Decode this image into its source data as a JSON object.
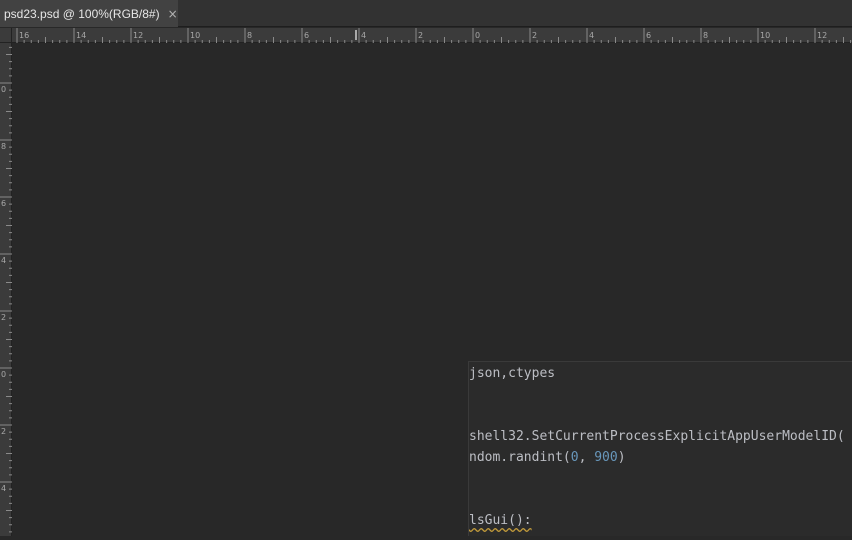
{
  "tab": {
    "title": "psd23.psd @ 100%(RGB/8#)",
    "close_glyph": "×"
  },
  "ruler": {
    "horizontal_labels": [
      "16",
      "14",
      "12",
      "10",
      "8",
      "6",
      "4",
      "2",
      "0",
      "2",
      "4",
      "6",
      "8",
      "10",
      "12"
    ],
    "vertical_labels": [
      "0",
      "8",
      "6",
      "4",
      "2",
      "0",
      "2",
      "4"
    ]
  },
  "code": {
    "line1": "json,ctypes",
    "line2": "shell32.SetCurrentProcessExplicitAppUserModelID(",
    "line3_prefix": "ndom.randint(",
    "line3_n1": "0",
    "line3_sep": ", ",
    "line3_n2": "900",
    "line3_suffix": ")",
    "line4": "lsGui():"
  },
  "colors": {
    "background": "#282828",
    "tab_active": "#424242",
    "ruler": "#3b3b3b",
    "code_text": "#bcbec4",
    "code_number": "#6897bb"
  }
}
